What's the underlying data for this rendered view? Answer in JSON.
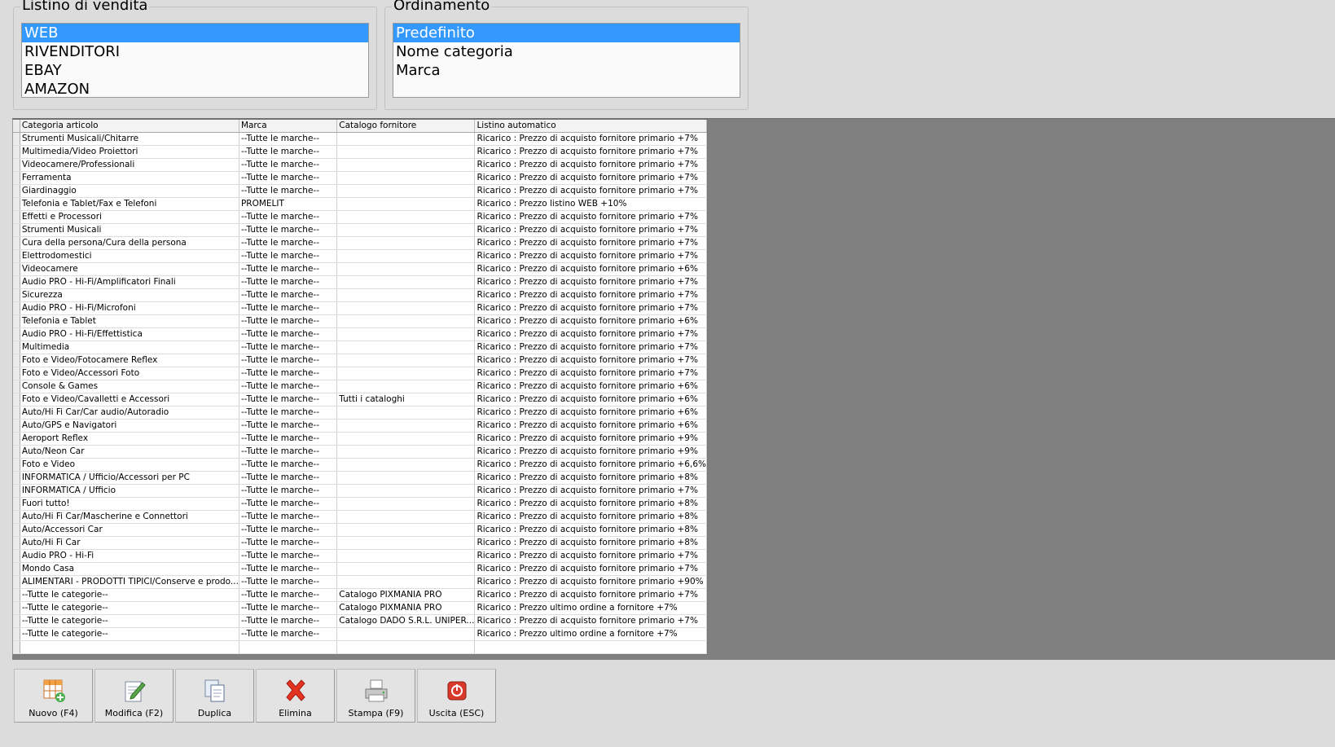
{
  "listino": {
    "title": "Listino di vendita",
    "items": [
      "WEB",
      "RIVENDITORI",
      "EBAY",
      "AMAZON"
    ],
    "selected": 0
  },
  "ordinamento": {
    "title": "Ordinamento",
    "items": [
      "Predefinito",
      "Nome categoria",
      "Marca"
    ],
    "selected": 0
  },
  "table": {
    "columns": [
      "Categoria articolo",
      "Marca",
      "Catalogo fornitore",
      "Listino automatico"
    ],
    "rows": [
      [
        "Strumenti Musicali/Chitarre",
        "--Tutte le marche--",
        "",
        "Ricarico : Prezzo di acquisto fornitore primario +7%"
      ],
      [
        "Multimedia/Video Proiettori",
        "--Tutte le marche--",
        "",
        "Ricarico : Prezzo di acquisto fornitore primario +7%"
      ],
      [
        "Videocamere/Professionali",
        "--Tutte le marche--",
        "",
        "Ricarico : Prezzo di acquisto fornitore primario +7%"
      ],
      [
        "Ferramenta",
        "--Tutte le marche--",
        "",
        "Ricarico : Prezzo di acquisto fornitore primario +7%"
      ],
      [
        "Giardinaggio",
        "--Tutte le marche--",
        "",
        "Ricarico : Prezzo di acquisto fornitore primario +7%"
      ],
      [
        "Telefonia e Tablet/Fax e Telefoni",
        "PROMELIT",
        "",
        "Ricarico : Prezzo listino WEB +10%"
      ],
      [
        "Effetti e Processori",
        "--Tutte le marche--",
        "",
        "Ricarico : Prezzo di acquisto fornitore primario +7%"
      ],
      [
        "Strumenti Musicali",
        "--Tutte le marche--",
        "",
        "Ricarico : Prezzo di acquisto fornitore primario +7%"
      ],
      [
        "Cura della persona/Cura della persona",
        "--Tutte le marche--",
        "",
        "Ricarico : Prezzo di acquisto fornitore primario +7%"
      ],
      [
        "Elettrodomestici",
        "--Tutte le marche--",
        "",
        "Ricarico : Prezzo di acquisto fornitore primario +7%"
      ],
      [
        "Videocamere",
        "--Tutte le marche--",
        "",
        "Ricarico : Prezzo di acquisto fornitore primario +6%"
      ],
      [
        "Audio PRO - Hi-Fi/Amplificatori Finali",
        "--Tutte le marche--",
        "",
        "Ricarico : Prezzo di acquisto fornitore primario +7%"
      ],
      [
        "Sicurezza",
        "--Tutte le marche--",
        "",
        "Ricarico : Prezzo di acquisto fornitore primario +7%"
      ],
      [
        "Audio PRO - Hi-Fi/Microfoni",
        "--Tutte le marche--",
        "",
        "Ricarico : Prezzo di acquisto fornitore primario +7%"
      ],
      [
        "Telefonia e Tablet",
        "--Tutte le marche--",
        "",
        "Ricarico : Prezzo di acquisto fornitore primario +6%"
      ],
      [
        "Audio PRO - Hi-Fi/Effettistica",
        "--Tutte le marche--",
        "",
        "Ricarico : Prezzo di acquisto fornitore primario +7%"
      ],
      [
        "Multimedia",
        "--Tutte le marche--",
        "",
        "Ricarico : Prezzo di acquisto fornitore primario +7%"
      ],
      [
        "Foto e Video/Fotocamere Reflex",
        "--Tutte le marche--",
        "",
        "Ricarico : Prezzo di acquisto fornitore primario +7%"
      ],
      [
        "Foto e Video/Accessori Foto",
        "--Tutte le marche--",
        "",
        "Ricarico : Prezzo di acquisto fornitore primario +7%"
      ],
      [
        "Console & Games",
        "--Tutte le marche--",
        "",
        "Ricarico : Prezzo di acquisto fornitore primario +6%"
      ],
      [
        "Foto e Video/Cavalletti e Accessori",
        "--Tutte le marche--",
        "Tutti i cataloghi",
        "Ricarico : Prezzo di acquisto fornitore primario +6%"
      ],
      [
        "Auto/Hi Fi Car/Car audio/Autoradio",
        "--Tutte le marche--",
        "",
        "Ricarico : Prezzo di acquisto fornitore primario +6%"
      ],
      [
        "Auto/GPS e Navigatori",
        "--Tutte le marche--",
        "",
        "Ricarico : Prezzo di acquisto fornitore primario +6%"
      ],
      [
        "Aeroport Reflex",
        "--Tutte le marche--",
        "",
        "Ricarico : Prezzo di acquisto fornitore primario +9%"
      ],
      [
        "Auto/Neon Car",
        "--Tutte le marche--",
        "",
        "Ricarico : Prezzo di acquisto fornitore primario +9%"
      ],
      [
        "Foto e Video",
        "--Tutte le marche--",
        "",
        "Ricarico : Prezzo di acquisto fornitore primario +6,6%"
      ],
      [
        "INFORMATICA / Ufficio/Accessori per PC",
        "--Tutte le marche--",
        "",
        "Ricarico : Prezzo di acquisto fornitore primario +8%"
      ],
      [
        "INFORMATICA / Ufficio",
        "--Tutte le marche--",
        "",
        "Ricarico : Prezzo di acquisto fornitore primario +7%"
      ],
      [
        "Fuori tutto!",
        "--Tutte le marche--",
        "",
        "Ricarico : Prezzo di acquisto fornitore primario +8%"
      ],
      [
        "Auto/Hi Fi Car/Mascherine e Connettori",
        "--Tutte le marche--",
        "",
        "Ricarico : Prezzo di acquisto fornitore primario +8%"
      ],
      [
        "Auto/Accessori Car",
        "--Tutte le marche--",
        "",
        "Ricarico : Prezzo di acquisto fornitore primario +8%"
      ],
      [
        "Auto/Hi Fi Car",
        "--Tutte le marche--",
        "",
        "Ricarico : Prezzo di acquisto fornitore primario +8%"
      ],
      [
        "Audio PRO - Hi-Fi",
        "--Tutte le marche--",
        "",
        "Ricarico : Prezzo di acquisto fornitore primario +7%"
      ],
      [
        "Mondo Casa",
        "--Tutte le marche--",
        "",
        "Ricarico : Prezzo di acquisto fornitore primario +7%"
      ],
      [
        "ALIMENTARI - PRODOTTI TIPICI/Conserve e prodo...",
        "--Tutte le marche--",
        "",
        "Ricarico : Prezzo di acquisto fornitore primario +90%"
      ],
      [
        "--Tutte le categorie--",
        "--Tutte le marche--",
        "Catalogo PIXMANIA PRO",
        "Ricarico : Prezzo di acquisto fornitore primario +7%"
      ],
      [
        "--Tutte le categorie--",
        "--Tutte le marche--",
        "Catalogo PIXMANIA PRO",
        "Ricarico : Prezzo ultimo ordine a fornitore +7%"
      ],
      [
        "--Tutte le categorie--",
        "--Tutte le marche--",
        "Catalogo DADO S.R.L. UNIPER...",
        "Ricarico : Prezzo di acquisto fornitore primario +7%"
      ],
      [
        "--Tutte le categorie--",
        "--Tutte le marche--",
        "",
        "Ricarico : Prezzo ultimo ordine a fornitore +7%"
      ]
    ]
  },
  "toolbar": {
    "buttons": [
      {
        "label": "Nuovo (F4)",
        "icon": "new-grid-icon"
      },
      {
        "label": "Modifica (F2)",
        "icon": "edit-icon"
      },
      {
        "label": "Duplica",
        "icon": "duplicate-icon"
      },
      {
        "label": "Elimina",
        "icon": "delete-icon"
      },
      {
        "label": "Stampa (F9)",
        "icon": "print-icon"
      },
      {
        "label": "Uscita (ESC)",
        "icon": "exit-icon"
      }
    ]
  },
  "colors": {
    "selection": "#3399ff",
    "background": "#dcdcdc",
    "grid_backdrop": "#808080"
  }
}
